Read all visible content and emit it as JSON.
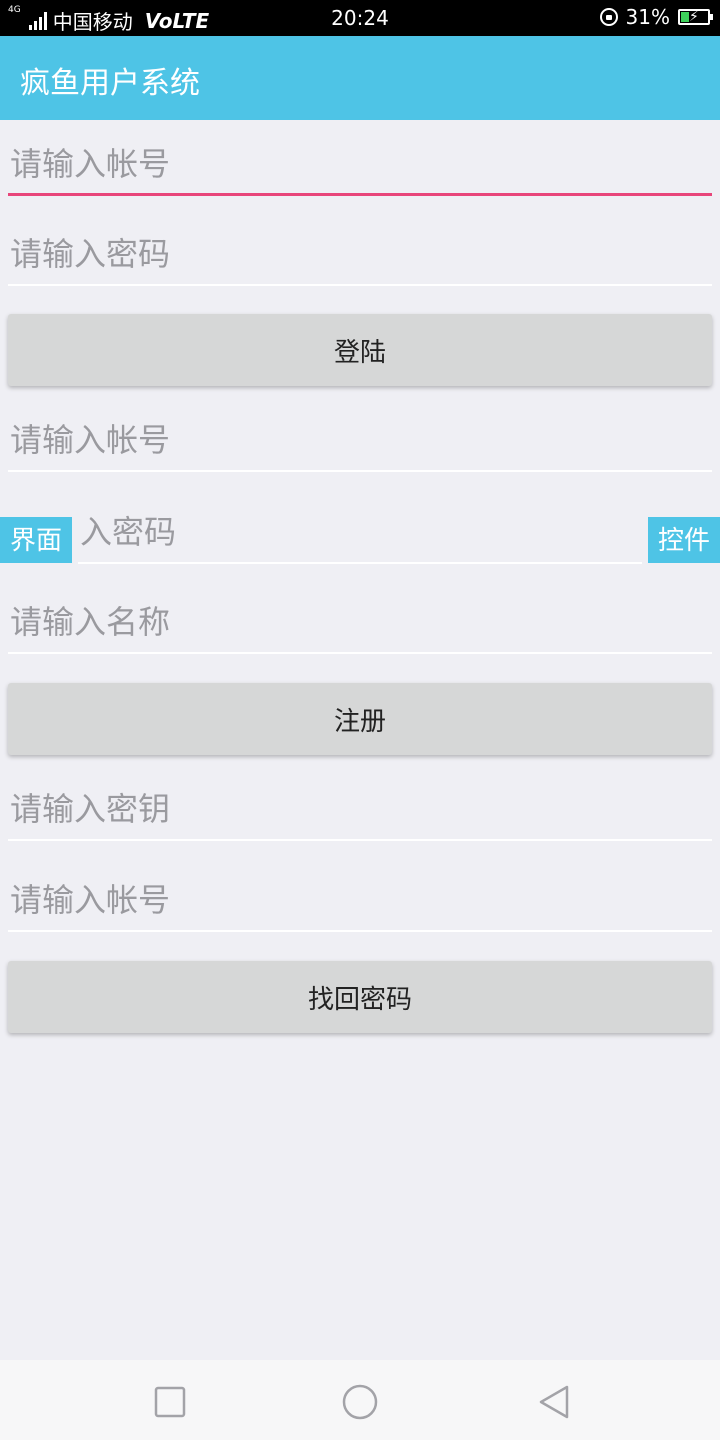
{
  "status_bar": {
    "network": "4G",
    "carrier": "中国移动",
    "volte": "VoLTE",
    "time": "20:24",
    "battery": "31%",
    "battery_level": 0.31
  },
  "app_bar": {
    "title": "疯鱼用户系统"
  },
  "login": {
    "account_placeholder": "请输入帐号",
    "password_placeholder": "请输入密码",
    "button_label": "登陆"
  },
  "register": {
    "account_placeholder": "请输入帐号",
    "password_placeholder": "入密码",
    "name_placeholder": "请输入名称",
    "button_label": "注册"
  },
  "recover": {
    "key_placeholder": "请输入密钥",
    "account_placeholder": "请输入帐号",
    "button_label": "找回密码"
  },
  "overlay_tags": {
    "left": "界面",
    "right": "控件"
  },
  "colors": {
    "app_bar": "#4ec4e6",
    "focus_underline": "#e8457a",
    "button": "#d6d7d7",
    "background": "#efeff4"
  },
  "nav_bar": {
    "icons": [
      "square-icon",
      "circle-icon",
      "back-triangle-icon"
    ]
  }
}
